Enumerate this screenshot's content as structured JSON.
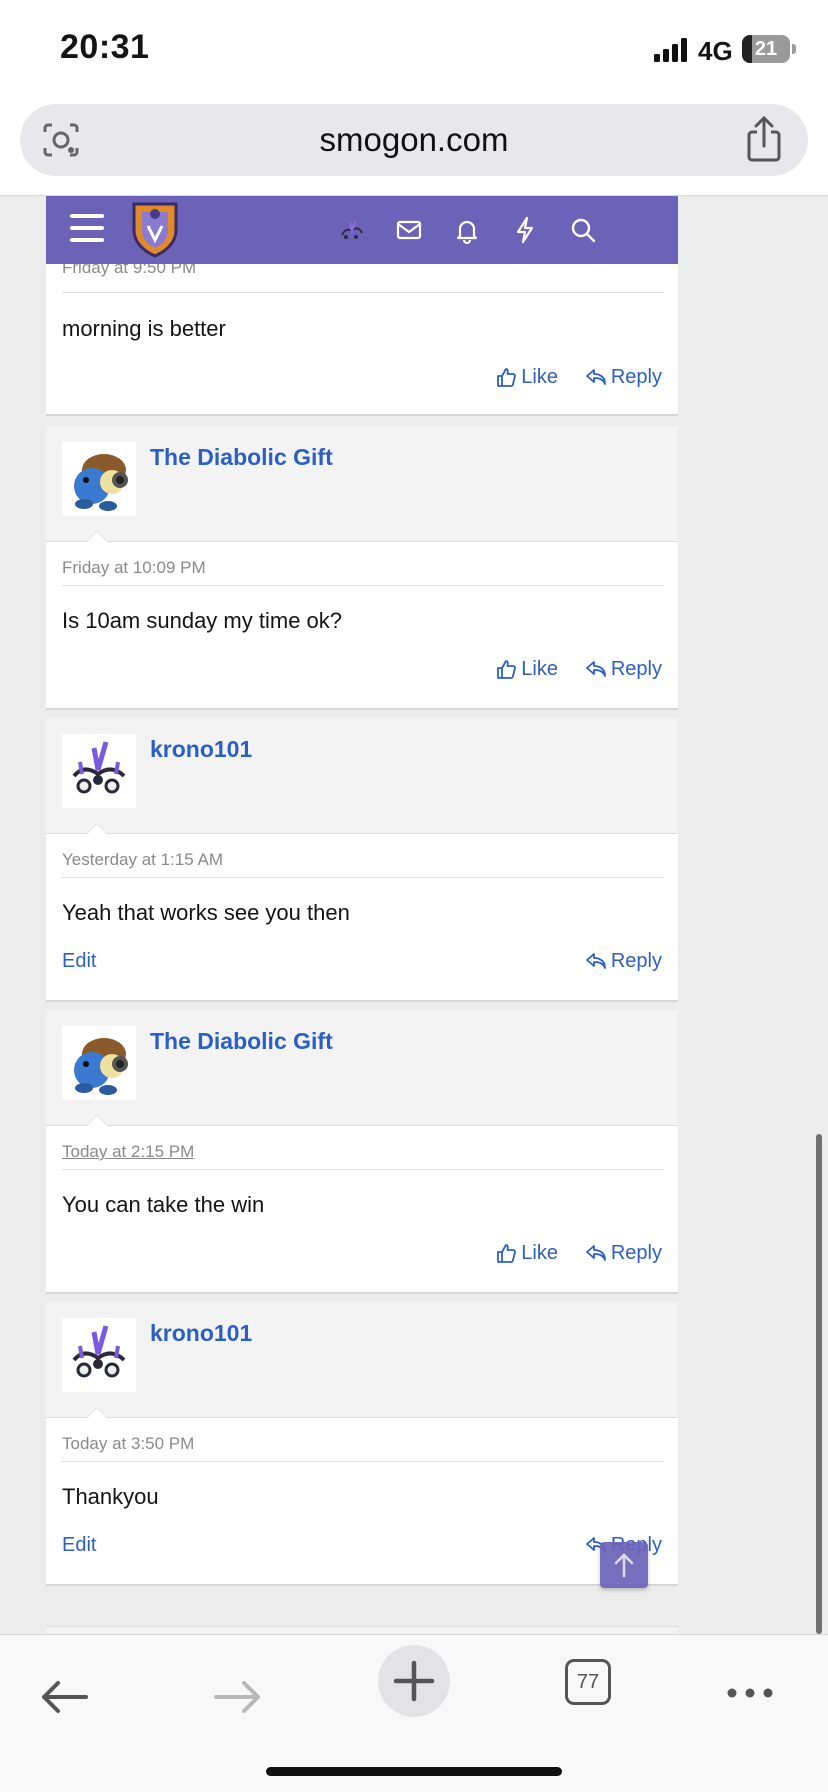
{
  "status": {
    "time": "20:31",
    "network": "4G",
    "battery": "21"
  },
  "browser": {
    "url": "smogon.com",
    "tab_count": "77"
  },
  "posts": [
    {
      "date": "Friday at 9:50 PM",
      "message": "morning is better",
      "like": "Like",
      "reply": "Reply"
    },
    {
      "username": "The Diabolic Gift",
      "date": "Friday at 10:09 PM",
      "message": "Is 10am sunday my time ok?",
      "like": "Like",
      "reply": "Reply"
    },
    {
      "username": "krono101",
      "date": "Yesterday at 1:15 AM",
      "message": "Yeah that works see you then",
      "edit": "Edit",
      "reply": "Reply"
    },
    {
      "username": "The Diabolic Gift",
      "date": "Today at 2:15 PM",
      "message": "You can take the win",
      "like": "Like",
      "reply": "Reply"
    },
    {
      "username": "krono101",
      "date": "Today at 3:50 PM",
      "message": "Thankyou",
      "edit": "Edit",
      "reply": "Reply"
    }
  ],
  "colors": {
    "nav": "#6c63b8",
    "link": "#2b5fc6"
  }
}
